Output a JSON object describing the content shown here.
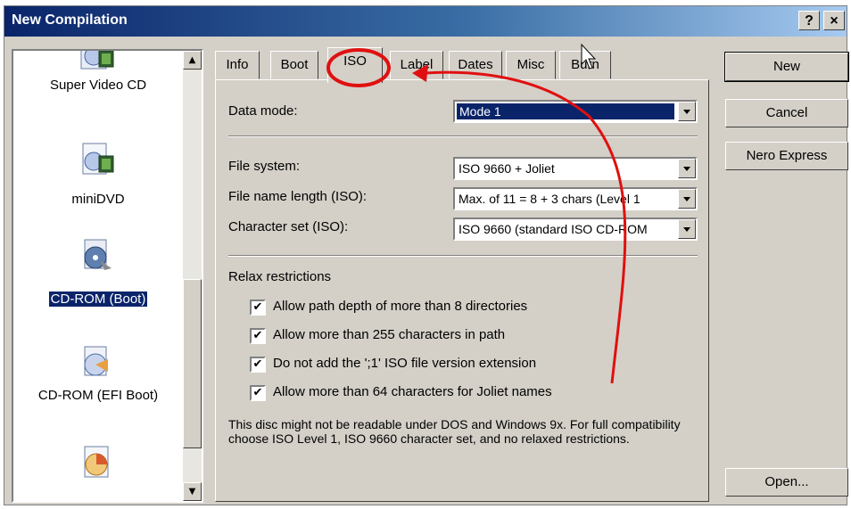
{
  "window": {
    "title": "New Compilation",
    "help_glyph": "?",
    "close_glyph": "×"
  },
  "left_list": {
    "items": [
      {
        "label": "Super Video CD",
        "icon": "video-disc-icon",
        "selected": false
      },
      {
        "label": "miniDVD",
        "icon": "video-disc-icon",
        "selected": false
      },
      {
        "label": "CD-ROM (Boot)",
        "icon": "boot-disc-icon",
        "selected": true
      },
      {
        "label": "CD-ROM (EFI Boot)",
        "icon": "efi-boot-disc-icon",
        "selected": false
      },
      {
        "label": "",
        "icon": "disc-icon",
        "selected": false
      }
    ],
    "scroll_up_glyph": "▲",
    "scroll_down_glyph": "▼"
  },
  "tabs": [
    {
      "label": "Info"
    },
    {
      "label": "Boot"
    },
    {
      "label": "ISO",
      "active": true
    },
    {
      "label": "Label"
    },
    {
      "label": "Dates"
    },
    {
      "label": "Misc"
    },
    {
      "label": "Burn"
    }
  ],
  "iso": {
    "data_mode": {
      "label": "Data mode:",
      "value": "Mode 1"
    },
    "file_system": {
      "label": "File system:",
      "value": "ISO 9660 + Joliet"
    },
    "file_name_length": {
      "label": "File name length (ISO):",
      "value": "Max. of 11 = 8 + 3 chars (Level 1"
    },
    "character_set": {
      "label": "Character set (ISO):",
      "value": "ISO 9660 (standard ISO CD-ROM"
    },
    "relax_title": "Relax restrictions",
    "check_glyph": "✔",
    "checks": [
      {
        "label": "Allow path depth of more than 8 directories",
        "checked": true
      },
      {
        "label": "Allow more than 255 characters in path",
        "checked": true
      },
      {
        "label": "Do not add the ';1' ISO file version extension",
        "checked": true
      },
      {
        "label": "Allow more than 64 characters for Joliet names",
        "checked": true
      }
    ],
    "note": "This disc might not be readable under DOS and Windows 9x. For full compatibility choose ISO Level 1, ISO 9660 character set, and no relaxed restrictions."
  },
  "buttons": {
    "new": "New",
    "cancel": "Cancel",
    "nero_express": "Nero Express",
    "open": "Open..."
  },
  "colors": {
    "selection": "#0a246a",
    "annotation": "#e01010",
    "face": "#d4d0c8"
  }
}
